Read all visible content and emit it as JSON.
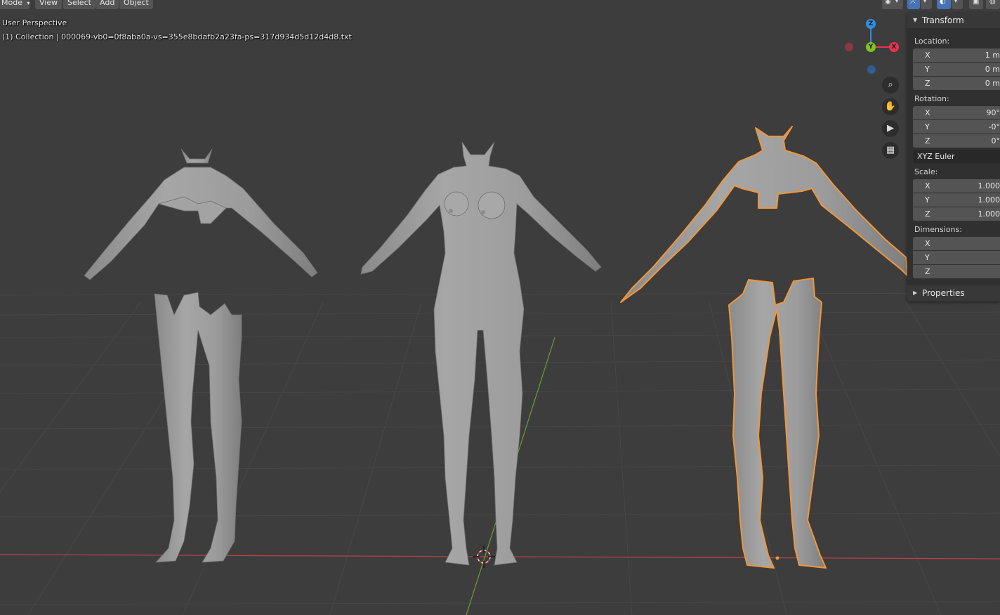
{
  "header": {
    "mode_label": "Mode",
    "menu": [
      "View",
      "Select",
      "Add",
      "Object"
    ]
  },
  "viewport": {
    "view_name": "User Perspective",
    "collection_info": "(1) Collection | 000069-vb0=0f8aba0a-vs=355e8bdafb2a23fa-ps=317d934d5d12d4d8.txt",
    "gizmo_axes": [
      "Z",
      "Y",
      "X"
    ],
    "nav_icons": [
      "zoom-icon",
      "hand-pan-icon",
      "camera-icon",
      "grid-ortho-icon"
    ]
  },
  "npanel": {
    "transform_title": "Transform",
    "location_label": "Location:",
    "location": [
      {
        "axis": "X",
        "value": "1 m"
      },
      {
        "axis": "Y",
        "value": "0 m"
      },
      {
        "axis": "Z",
        "value": "0 m"
      }
    ],
    "rotation_label": "Rotation:",
    "rotation": [
      {
        "axis": "X",
        "value": "90°"
      },
      {
        "axis": "Y",
        "value": "-0°"
      },
      {
        "axis": "Z",
        "value": "0°"
      }
    ],
    "rotation_mode": "XYZ Euler",
    "scale_label": "Scale:",
    "scale": [
      {
        "axis": "X",
        "value": "1.000"
      },
      {
        "axis": "Y",
        "value": "1.000"
      },
      {
        "axis": "Z",
        "value": "1.000"
      }
    ],
    "dimensions_label": "Dimensions:",
    "dimensions": [
      {
        "axis": "X",
        "value": ""
      },
      {
        "axis": "Y",
        "value": ""
      },
      {
        "axis": "Z",
        "value": ""
      }
    ],
    "properties_title": "Properties"
  },
  "colors": {
    "background": "#3d3d3d",
    "mesh": "#9a9a9a",
    "selection_outline": "#f0963a",
    "axis_x": "#e8344e",
    "axis_y": "#7ec31e",
    "axis_z": "#2d8fe6"
  }
}
